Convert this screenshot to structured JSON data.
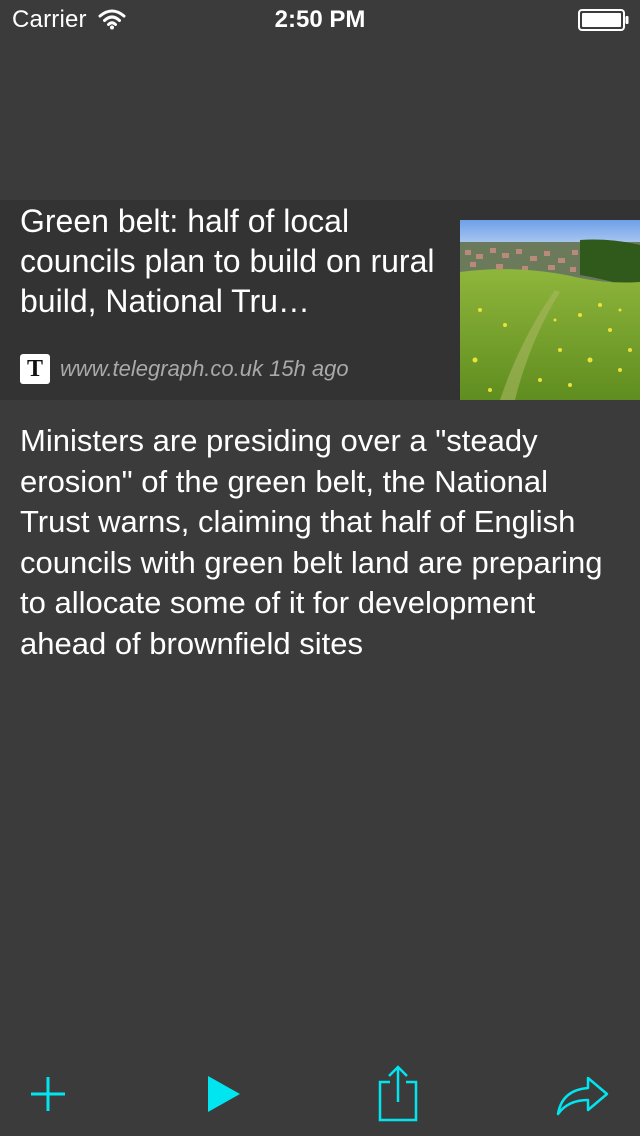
{
  "status_bar": {
    "carrier": "Carrier",
    "time": "2:50 PM"
  },
  "article": {
    "headline": "Green belt: half of local councils plan to build on rural build, National Tru…",
    "source_logo_letter": "T",
    "source_meta": "www.telegraph.co.uk 15h ago",
    "summary": "Ministers are presiding over a \"steady erosion\" of the green belt, the National Trust warns, claiming that half of English councils with green belt land are preparing to allocate some of it for development ahead of brownfield sites"
  },
  "toolbar": {
    "icons": [
      "plus-icon",
      "play-icon",
      "share-icon",
      "forward-icon"
    ],
    "accent_color": "#00e5f0"
  },
  "colors": {
    "background": "#3b3b3b",
    "header_card": "#333333",
    "meta_text": "#a9a9a9"
  }
}
